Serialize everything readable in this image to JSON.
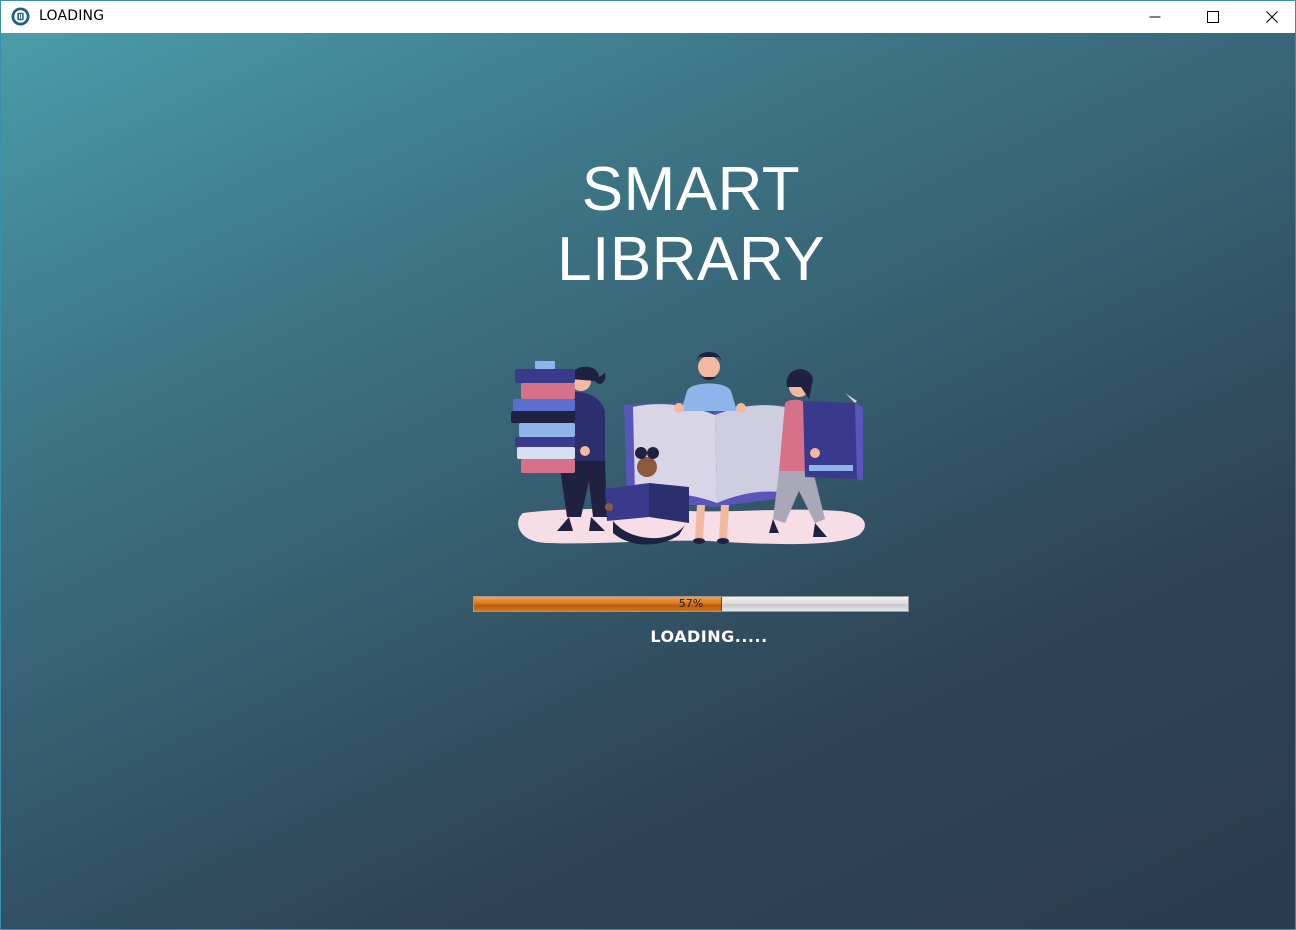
{
  "window": {
    "title": "LOADING",
    "icon": "app-icon",
    "controls": {
      "minimize_icon": "minimize-icon",
      "maximize_icon": "maximize-icon",
      "close_icon": "close-icon"
    }
  },
  "main": {
    "title": "SMART LIBRARY",
    "illustration": "people-reading-books-illustration",
    "progress": {
      "value": 57,
      "label": "57%",
      "fill_color": "#d97a1e"
    },
    "status_text": "LOADING....."
  },
  "colors": {
    "gradient_top_left": "#4a9ca9",
    "gradient_bottom_right": "#2c3b4f",
    "title_color": "#ffffff"
  }
}
